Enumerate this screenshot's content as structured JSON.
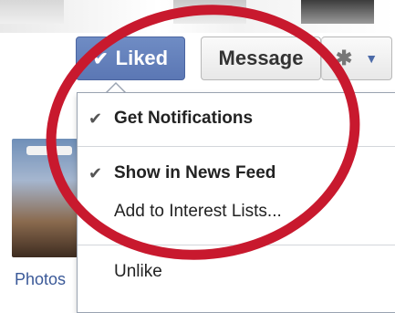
{
  "page_buttons": {
    "liked_label": "Liked",
    "liked_check": "✔",
    "message_label": "Message",
    "gear_glyph": "✱",
    "caret_glyph": "▼"
  },
  "icons": {
    "liked_check": "checkmark-icon",
    "gear": "gear-icon",
    "caret": "chevron-down-icon"
  },
  "left_column": {
    "photos_link": "Photos"
  },
  "menu": {
    "items": [
      {
        "label": "Get Notifications",
        "checked": true,
        "bold": true,
        "check": "✔"
      },
      {
        "label": "Show in News Feed",
        "checked": true,
        "bold": true,
        "check": "✔"
      },
      {
        "label": "Add to Interest Lists...",
        "checked": false,
        "bold": false,
        "check": ""
      },
      {
        "label": "Unlike",
        "checked": false,
        "bold": false,
        "check": ""
      }
    ]
  },
  "colors": {
    "liked_button": "#5b77b4",
    "link": "#3b5998",
    "annotation": "#c8192e"
  }
}
